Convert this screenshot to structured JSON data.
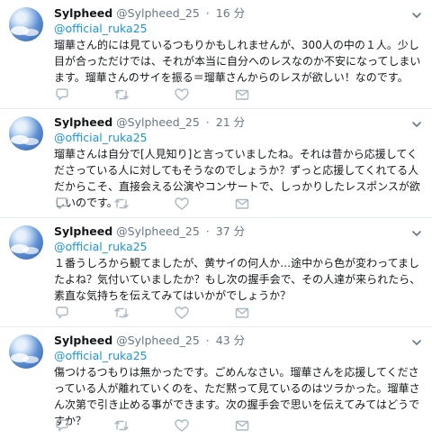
{
  "tweets": [
    {
      "name": "Sylpheed",
      "handle": "@Sylpheed_25",
      "separator": "·",
      "time": "16 分",
      "reply_to": "@official_ruka25",
      "body": "瑠華さん的には見ているつもりかもしれませんが、300人の中の１人。少し目が合っただけでは、それが本当に自分へのレスなのか不安になってしまいます。瑠華さんのサイを振る＝瑠華さんからのレスが欲しい！なのです。"
    },
    {
      "name": "Sylpheed",
      "handle": "@Sylpheed_25",
      "separator": "·",
      "time": "21 分",
      "reply_to": "@official_ruka25",
      "body": "瑠華さんは自分で[人見知り]と言っていましたね。それは昔から応援してくださっている人に対してもそうなのでしょうか？ずっと応援してくれてる人だからこそ、直接会える公演やコンサートで、しっかりしたレスポンスが欲しいのです。"
    },
    {
      "name": "Sylpheed",
      "handle": "@Sylpheed_25",
      "separator": "·",
      "time": "37 分",
      "reply_to": "@official_ruka25",
      "body": "１番うしろから観てましたが、黄サイの何人か…途中から色が変わってましたよね？気付いていましたか？もし次の握手会で、その人達が来られたら、素直な気持ちを伝えてみてはいかがでしょうか？"
    },
    {
      "name": "Sylpheed",
      "handle": "@Sylpheed_25",
      "separator": "·",
      "time": "43 分",
      "reply_to": "@official_ruka25",
      "body": "傷つけるつもりは無かったです。ごめんなさい。瑠華さんを応援してくださっている人が離れていくのを、ただ黙って見ているのはツラかった。瑠華さん次第で引き止める事ができます。次の握手会で思いを伝えてみてはどうですか？"
    }
  ],
  "icons": {
    "avatar": "sky-clouds-avatar",
    "menu": "chevron-down-icon",
    "reply": "reply-icon",
    "retweet": "retweet-icon",
    "like": "heart-icon",
    "dm": "envelope-icon"
  },
  "colors": {
    "link": "#1b95e0",
    "muted": "#657786",
    "text": "#14171a",
    "divider": "#e6ecf0"
  }
}
